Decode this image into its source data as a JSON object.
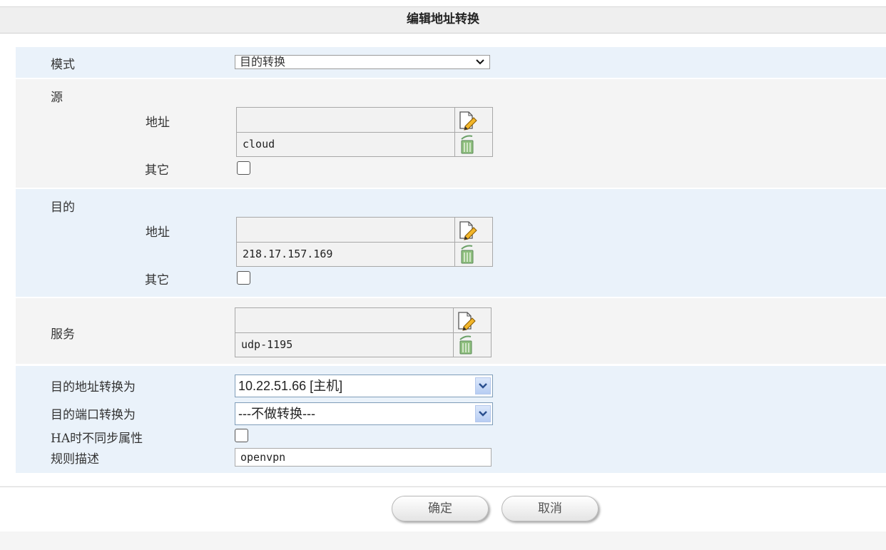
{
  "title": "编辑地址转换",
  "mode": {
    "label": "模式",
    "value": "目的转换"
  },
  "source": {
    "label": "源",
    "address_label": "地址",
    "address_value": "cloud",
    "other_label": "其它",
    "other_checked": false
  },
  "destination": {
    "label": "目的",
    "address_label": "地址",
    "address_value": "218.17.157.169",
    "other_label": "其它",
    "other_checked": false
  },
  "service": {
    "label": "服务",
    "value": "udp-1195"
  },
  "translate": {
    "dest_addr_label": "目的地址转换为",
    "dest_addr_value": "10.22.51.66 [主机]",
    "dest_port_label": "目的端口转换为",
    "dest_port_value": "---不做转换---",
    "ha_label": "HA时不同步属性",
    "ha_checked": false,
    "desc_label": "规则描述",
    "desc_value": "openvpn"
  },
  "buttons": {
    "ok": "确定",
    "cancel": "取消"
  },
  "icons": {
    "edit": "edit-icon",
    "delete": "trash-icon"
  },
  "colors": {
    "row_blue": "#eaf2fa",
    "row_gray": "#f4f4f4",
    "combo_border": "#7f9db9"
  }
}
